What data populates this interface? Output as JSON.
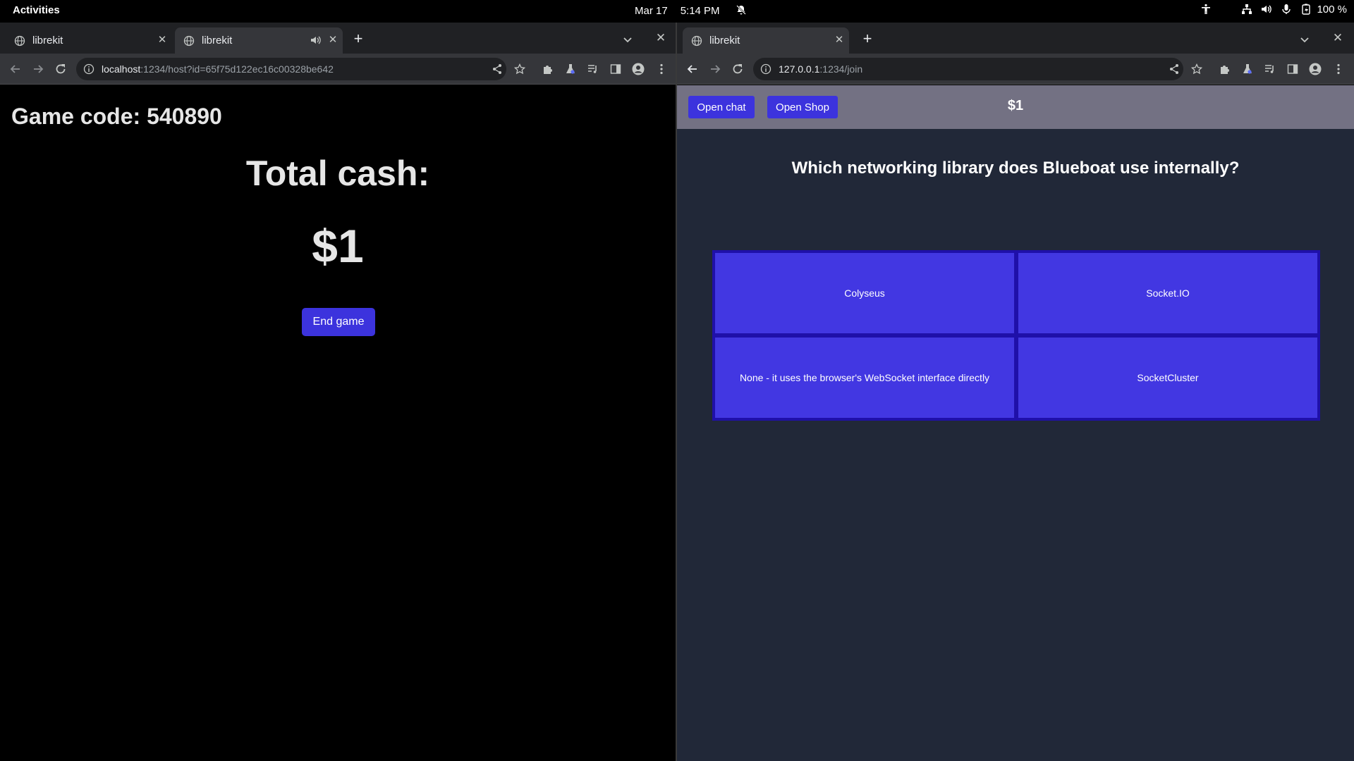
{
  "topbar": {
    "activities": "Activities",
    "date": "Mar 17",
    "time": "5:14 PM",
    "battery": "100 %",
    "icons": [
      "notifications-off-icon",
      "accessibility-icon",
      "network-icon",
      "volume-icon",
      "microphone-icon",
      "battery-icon"
    ]
  },
  "left_window": {
    "tabs": [
      {
        "title": "librekit",
        "active": false
      },
      {
        "title": "librekit",
        "active": true,
        "muted": true
      }
    ],
    "url": {
      "host": "localhost",
      "rest": ":1234/host?id=65f75d122ec16c00328be642"
    },
    "page": {
      "game_code": "Game code: 540890",
      "total_label": "Total cash:",
      "total_value": "$1",
      "end_button": "End game"
    }
  },
  "right_window": {
    "tabs": [
      {
        "title": "librekit",
        "active": true
      }
    ],
    "url": {
      "host": "127.0.0.1",
      "rest": ":1234/join"
    },
    "page": {
      "open_chat": "Open chat",
      "open_shop": "Open Shop",
      "cash": "$1",
      "question": "Which networking library does Blueboat use internally?",
      "answers": [
        "Colyseus",
        "Socket.IO",
        "None - it uses the browser's WebSocket interface directly",
        "SocketCluster"
      ]
    }
  },
  "colors": {
    "accent": "#3c33dd",
    "answer_bg": "#4237e2",
    "answer_border": "#1f10a9",
    "right_bg": "#212838",
    "header_bg": "#737183"
  }
}
